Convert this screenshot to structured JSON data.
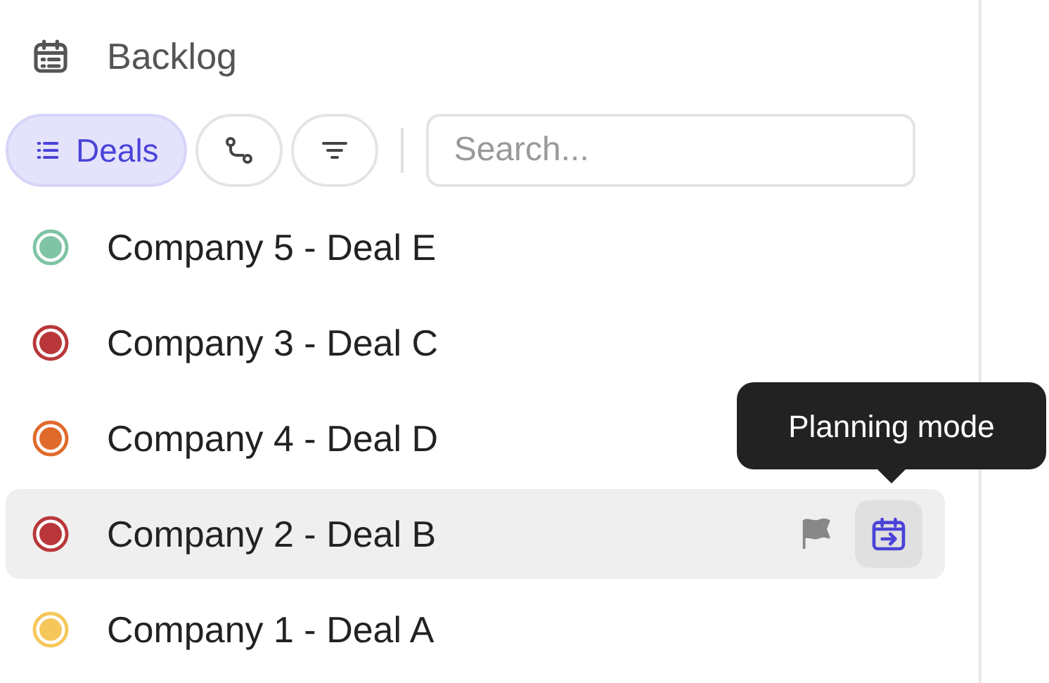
{
  "header": {
    "title": "Backlog"
  },
  "toolbar": {
    "tabs": [
      {
        "kind": "list",
        "label": "Deals",
        "selected": true
      },
      {
        "kind": "route",
        "selected": false
      },
      {
        "kind": "filter",
        "selected": false
      }
    ],
    "search": {
      "placeholder": "Search..."
    }
  },
  "deals": [
    {
      "name": "Company 5 - Deal E",
      "color": "#7fc4a4",
      "selected": false
    },
    {
      "name": "Company 3 - Deal C",
      "color": "#b9373a",
      "selected": false
    },
    {
      "name": "Company 4 - Deal D",
      "color": "#e06a2b",
      "selected": false
    },
    {
      "name": "Company 2 - Deal B",
      "color": "#b9373a",
      "selected": true
    },
    {
      "name": "Company 1 - Deal A",
      "color": "#f5c75a",
      "selected": false
    }
  ],
  "tooltip": {
    "text": "Planning mode"
  }
}
